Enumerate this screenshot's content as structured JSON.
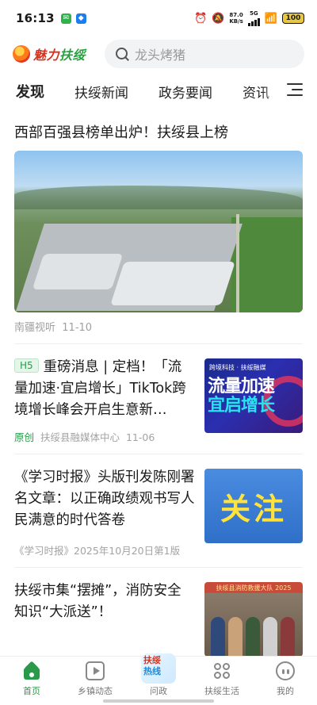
{
  "status_bar": {
    "time": "16:13",
    "net_speed_value": "87.0",
    "net_speed_unit": "KB/s",
    "network": "5G",
    "battery": "100"
  },
  "header": {
    "logo_text_a": "魅力",
    "logo_text_b": "扶绥",
    "search_placeholder": "龙头烤猪"
  },
  "tabs": [
    {
      "label": "发现",
      "active": true
    },
    {
      "label": "扶绥新闻"
    },
    {
      "label": "政务要闻"
    },
    {
      "label": "资讯"
    }
  ],
  "feed": {
    "featured": {
      "title": "西部百强县榜单出炉！扶绥县上榜",
      "source": "南疆视听",
      "date": "11-10"
    },
    "cards": [
      {
        "tag": "H5",
        "title": "重磅消息 | 定档！「流量加速·宜启增长」TikTok跨境增长峰会开启生意新…",
        "original": "原创",
        "source": "扶绥县融媒体中心",
        "date": "11-06",
        "thumb_text_top": "跨境科技 · 扶绥融媒",
        "thumb_text_main_a": "流量加速",
        "thumb_text_main_b": "宜启增长"
      },
      {
        "title": "《学习时报》头版刊发陈刚署名文章：以正确政绩观书写人民满意的时代答卷",
        "meta": "《学习时报》2025年10月20日第1版",
        "thumb_text": "关注"
      },
      {
        "title": "扶绥市集“摆摊”，消防安全知识“大派送”！",
        "thumb_banner": "扶绥县消防救援大队 2025"
      }
    ]
  },
  "bottom_nav": [
    {
      "label": "首页",
      "icon": "home-icon",
      "active": true
    },
    {
      "label": "乡镇动态",
      "icon": "video-icon"
    },
    {
      "label": "问政",
      "icon": "ask-hotline-icon",
      "badge_a": "扶绥",
      "badge_b": "热线"
    },
    {
      "label": "扶绥生活",
      "icon": "grid-icon"
    },
    {
      "label": "我的",
      "icon": "profile-icon"
    }
  ],
  "colors": {
    "accent_green": "#2a9a4a",
    "logo_red": "#d8321e",
    "meta_gray": "#a0a0a0"
  }
}
